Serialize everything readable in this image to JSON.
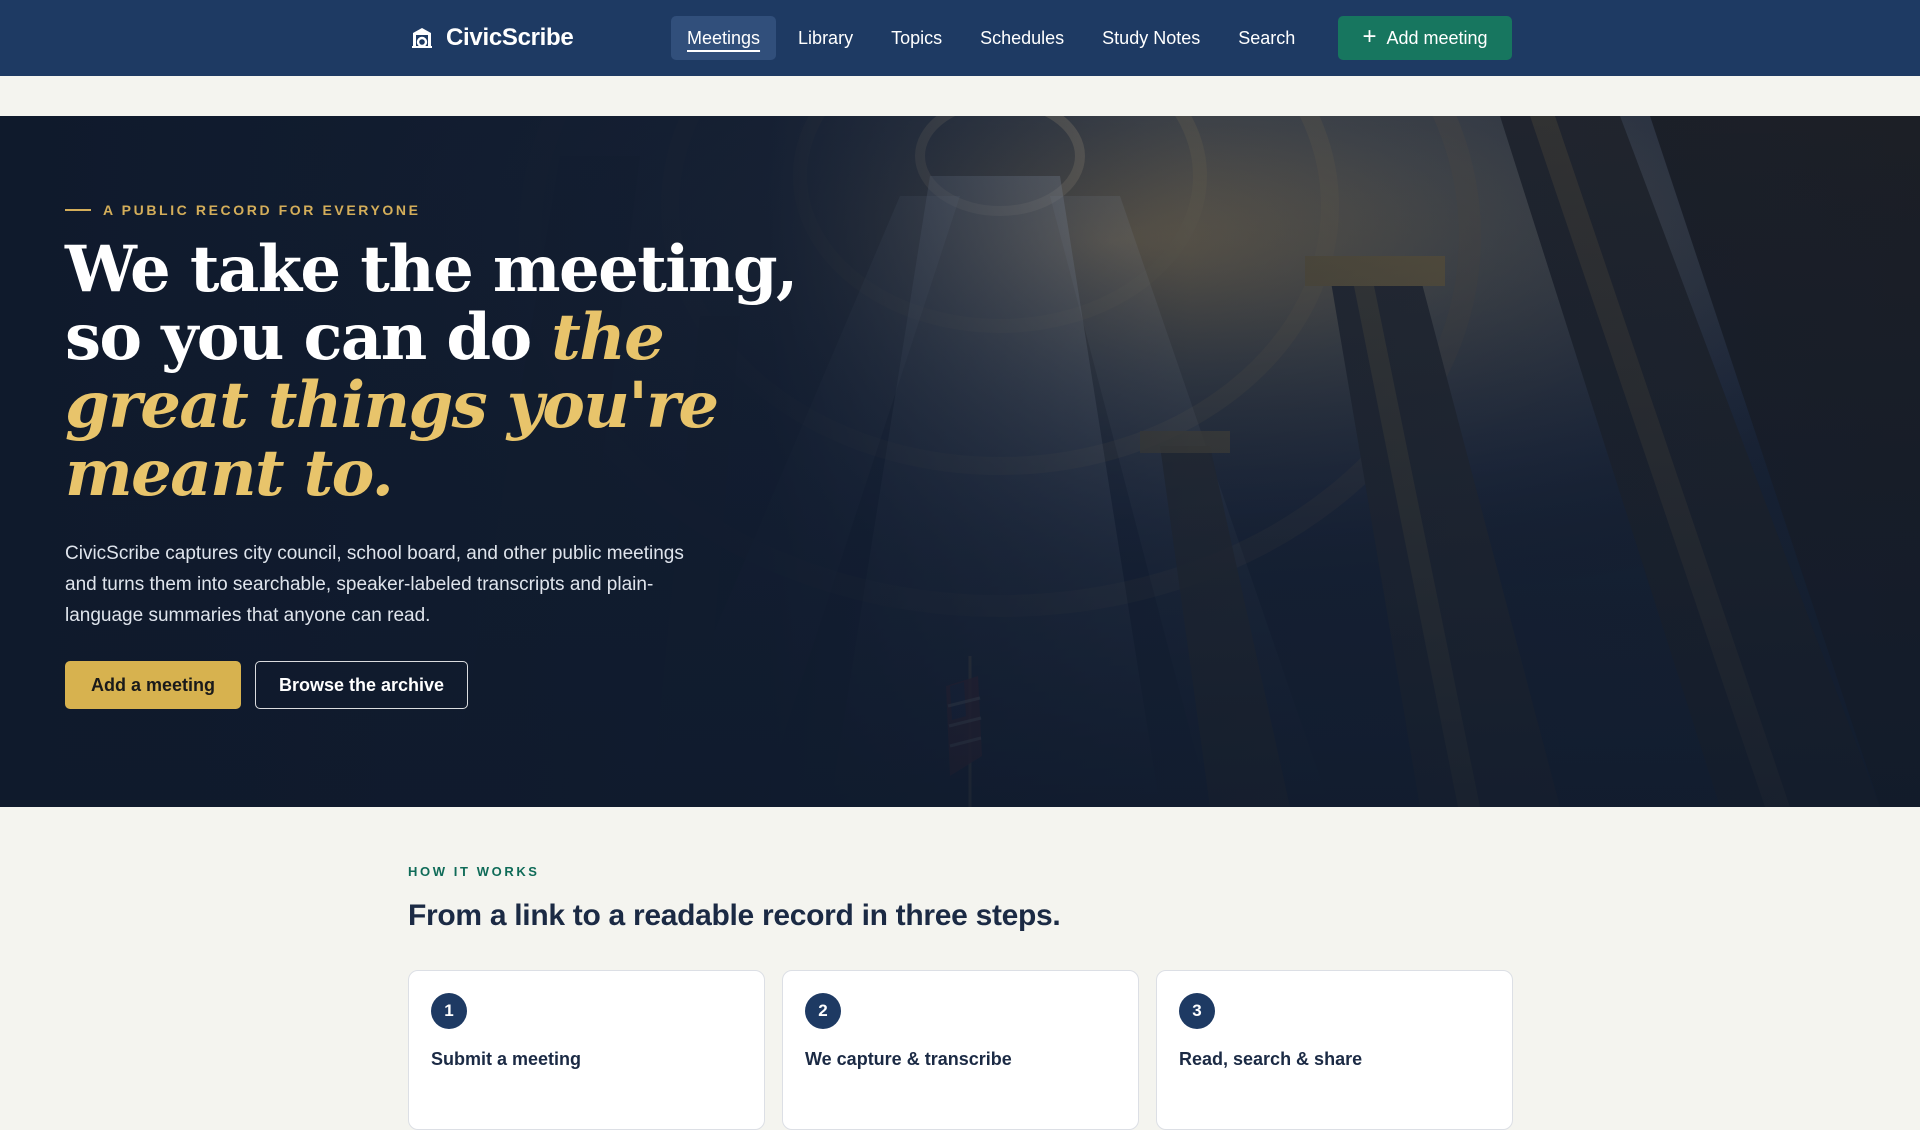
{
  "brand": {
    "name": "CivicScribe",
    "icon": "building-icon"
  },
  "nav": {
    "items": [
      {
        "label": "Meetings",
        "active": true
      },
      {
        "label": "Library",
        "active": false
      },
      {
        "label": "Topics",
        "active": false
      },
      {
        "label": "Schedules",
        "active": false
      },
      {
        "label": "Study Notes",
        "active": false
      },
      {
        "label": "Search",
        "active": false
      }
    ],
    "add_button": {
      "label": "Add meeting",
      "icon": "plus-icon"
    }
  },
  "hero": {
    "eyebrow": "A PUBLIC RECORD FOR EVERYONE",
    "headline_line1": "We take the meeting,",
    "headline_line2_start": "so you can do ",
    "headline_line2_accent": "the",
    "headline_accent_line3": "great things you're",
    "headline_accent_line4": "meant to.",
    "description": "CivicScribe captures city council, school board, and other public meetings and turns them into searchable, speaker-labeled transcripts and plain-language summaries that anyone can read.",
    "primary_button": "Add a meeting",
    "secondary_button": "Browse the archive",
    "background": "rotunda-columns-image"
  },
  "how_it_works": {
    "eyebrow": "HOW IT WORKS",
    "title": "From a link to a readable record in three steps.",
    "steps": [
      {
        "number": "1",
        "title": "Submit a meeting"
      },
      {
        "number": "2",
        "title": "We capture & transcribe"
      },
      {
        "number": "3",
        "title": "Read, search & share"
      }
    ]
  },
  "colors": {
    "nav_bg": "#1e3a63",
    "nav_active": "#314f7b",
    "add_button": "#17765f",
    "gold_accent": "#e8c46b",
    "primary_button": "#d7b24f",
    "page_bg": "#f4f4ef",
    "eyebrow_green": "#0f6b58"
  }
}
